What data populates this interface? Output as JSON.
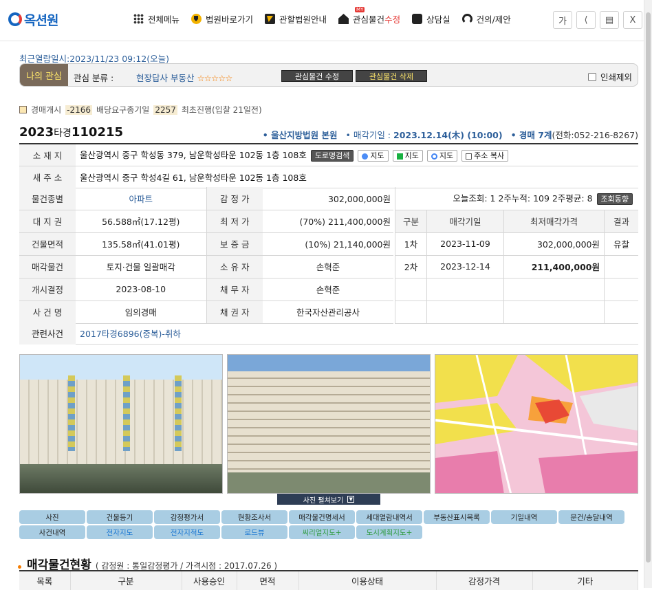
{
  "logo": {
    "text": "옥션원"
  },
  "nav": [
    {
      "label": "전체메뉴",
      "icon": "grid-icon"
    },
    {
      "label": "법원바로가기",
      "icon": "court-icon"
    },
    {
      "label": "관할법원안내",
      "icon": "note-icon"
    },
    {
      "label_main": "관심물건",
      "label_accent": "수정",
      "badge": "MY",
      "icon": "house-icon"
    },
    {
      "label": "상담실",
      "icon": "chat-icon"
    },
    {
      "label": "건의/제안",
      "icon": "headset-icon"
    }
  ],
  "window_buttons": {
    "font": "가",
    "share": "⇅",
    "print": "🖶",
    "close": "X"
  },
  "recent": "최근열람일시:2023/11/23 09:12(오늘)",
  "favorite": {
    "tag": "나의 관심",
    "label": "관심 분류 :",
    "category": "현장답사 부동산",
    "stars": "☆☆☆☆☆",
    "edit_btn": "관심물건 수정",
    "delete_btn": "관심물건 삭제",
    "print_exclude": "인쇄제외"
  },
  "status": {
    "start_label": "경매개시",
    "start_value": "-2166",
    "dividend_label": "배당요구종기일",
    "dividend_value": "2257",
    "first_label": "최초진행(입찰 21일전)"
  },
  "case": {
    "year": "2023",
    "type": "타경",
    "number": "110215",
    "court": "• 울산지방법원 본원",
    "sale_label": "• 매각기일 :",
    "sale_date": "2023.12.14(木) (10:00)",
    "dept": "• 경매 7계",
    "phone": "(전화:052-216-8267)"
  },
  "address": {
    "label": "소 재 지",
    "value": "울산광역시 중구 학성동 379, 남운학성타운 102동 1층 108호",
    "btn_road": "도로명검색",
    "btn_daum": "지도",
    "btn_naver": "지도",
    "btn_google": "지도",
    "btn_copy": "주소 복사",
    "new_label": "새 주 소",
    "new_value": "울산광역시 중구 학성4길 61, 남운학성타운 102동 1층 108호"
  },
  "info_rows": [
    {
      "h1": "물건종별",
      "v1": "아파트",
      "h2": "감 정 가",
      "v2": "302,000,000원"
    },
    {
      "h1": "대 지 권",
      "v1": "56.588㎡(17.12평)",
      "h2": "최 저 가",
      "v2": "(70%) 211,400,000원"
    },
    {
      "h1": "건물면적",
      "v1": "135.58㎡(41.01평)",
      "h2": "보 증 금",
      "v2": "(10%) 21,140,000원"
    },
    {
      "h1": "매각물건",
      "v1": "토지·건물 일괄매각",
      "h2": "소 유 자",
      "v2": "손혁준"
    },
    {
      "h1": "개시결정",
      "v1": "2023-08-10",
      "h2": "채 무 자",
      "v2": "손혁준"
    },
    {
      "h1": "사 건 명",
      "v1": "임의경매",
      "h2": "채 권 자",
      "v2": "한국자산관리공사"
    }
  ],
  "stats": {
    "views": "오늘조회: 1  2주누적: 109  2주평균: 8",
    "btn": "조회동향",
    "headers": [
      "구분",
      "매각기일",
      "최저매각가격",
      "결과"
    ],
    "rows": [
      {
        "round": "1차",
        "date": "2023-11-09",
        "price": "302,000,000원",
        "result": "유찰"
      },
      {
        "round": "2차",
        "date": "2023-12-14",
        "price": "211,400,000원",
        "result": ""
      }
    ]
  },
  "related": {
    "label": "관련사건",
    "value": "2017타경6896(중복)-취하"
  },
  "photo_toggle": "사진 펼쳐보기",
  "tabs": [
    {
      "label": "사진",
      "style": ""
    },
    {
      "label": "건물등기",
      "style": ""
    },
    {
      "label": "감정평가서",
      "style": ""
    },
    {
      "label": "현황조사서",
      "style": ""
    },
    {
      "label": "매각물건명세서",
      "style": ""
    },
    {
      "label": "세대열람내역서",
      "style": ""
    },
    {
      "label": "부동산표시목록",
      "style": ""
    },
    {
      "label": "기일내역",
      "style": ""
    },
    {
      "label": "문건/송달내역",
      "style": ""
    },
    {
      "label": "사건내역",
      "style": ""
    },
    {
      "label": "전자지도",
      "style": "blue"
    },
    {
      "label": "전자지적도",
      "style": "blue"
    },
    {
      "label": "로드뷰",
      "style": "blue"
    },
    {
      "label": "씨리얼지도+",
      "style": "green"
    },
    {
      "label": "도시계획지도+",
      "style": "green"
    }
  ],
  "section": {
    "title": "매각물건현황",
    "sub": "( 감정원 : 통일감정평가 / 가격시점 : 2017.07.26 )"
  },
  "bottom_headers": [
    "목록",
    "구분",
    "사용승인",
    "면적",
    "이용상태",
    "감정가격",
    "기타"
  ]
}
